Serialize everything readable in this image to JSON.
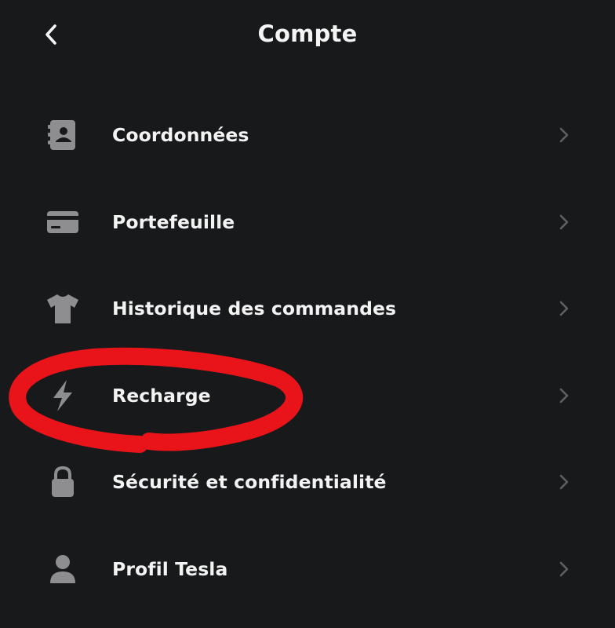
{
  "header": {
    "title": "Compte",
    "back_icon": "chevron-left-icon"
  },
  "menu": {
    "items": [
      {
        "label": "Coordonnées",
        "icon": "contact-book-icon"
      },
      {
        "label": "Portefeuille",
        "icon": "credit-card-icon"
      },
      {
        "label": "Historique des commandes",
        "icon": "tshirt-icon"
      },
      {
        "label": "Recharge",
        "icon": "lightning-bolt-icon"
      },
      {
        "label": "Sécurité et confidentialité",
        "icon": "lock-icon"
      },
      {
        "label": "Profil Tesla",
        "icon": "person-icon"
      }
    ],
    "chevron_icon": "chevron-right-icon"
  },
  "colors": {
    "background": "#18191b",
    "text": "#f3f3f3",
    "icon": "#8e8e90",
    "chevron": "#5f6064",
    "annotation": "#e8141a"
  }
}
